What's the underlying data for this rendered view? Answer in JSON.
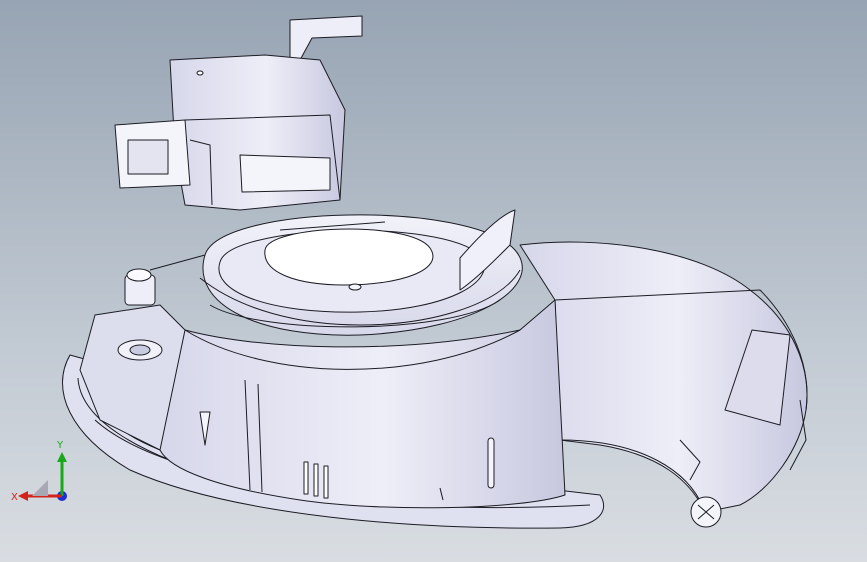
{
  "viewport": {
    "background_top": "#97a4b3",
    "background_bottom": "#d9dde2",
    "model_fill": "#e6e7f3",
    "model_shade": "#c9cbe0",
    "edge_color": "#1c1c24"
  },
  "triad": {
    "x_label": "X",
    "y_label": "Y",
    "x_color": "#d4231b",
    "y_color": "#1aa81a",
    "z_color": "#1f2fd0",
    "origin_icon": "view-orientation-icon"
  }
}
